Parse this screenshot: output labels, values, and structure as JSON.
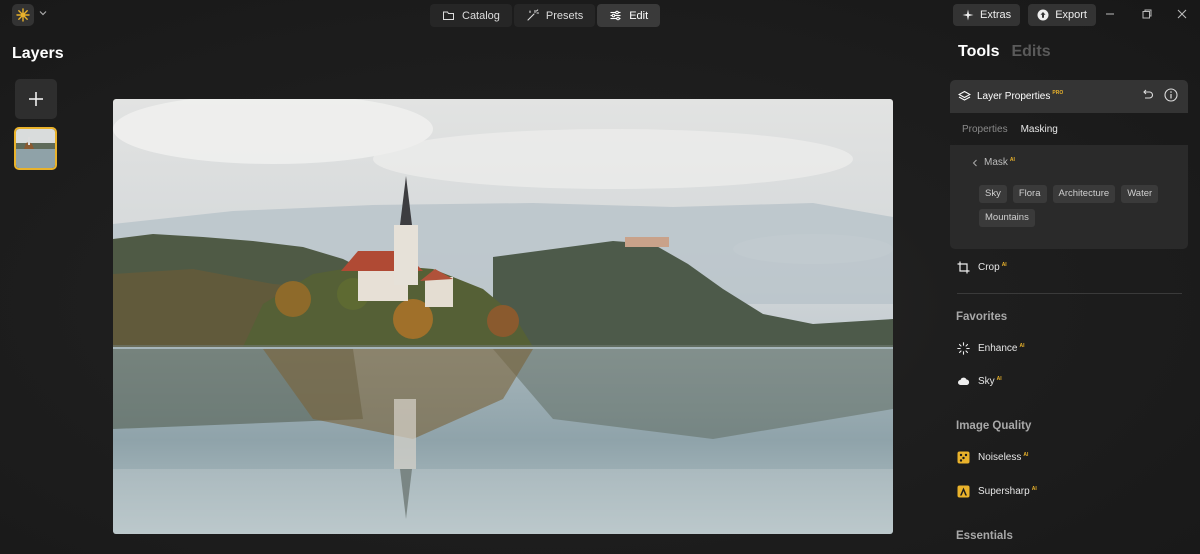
{
  "nav": {
    "catalog": "Catalog",
    "presets": "Presets",
    "edit": "Edit"
  },
  "actions": {
    "extras": "Extras",
    "export": "Export"
  },
  "layers": {
    "title": "Layers"
  },
  "tools_panel": {
    "tab_tools": "Tools",
    "tab_edits": "Edits",
    "layer_properties": {
      "title": "Layer Properties",
      "badge": "PRO",
      "subtabs": [
        "Properties",
        "Masking"
      ],
      "active_subtab": "Masking"
    },
    "mask": {
      "label": "Mask",
      "badge": "AI",
      "chips": [
        "Sky",
        "Flora",
        "Architecture",
        "Water",
        "Mountains"
      ]
    },
    "crop": {
      "label": "Crop",
      "badge": "AI"
    },
    "sections": {
      "favorites": "Favorites",
      "image_quality": "Image Quality",
      "essentials": "Essentials"
    },
    "favorites": [
      {
        "label": "Enhance",
        "badge": "AI",
        "icon": "enhance-icon"
      },
      {
        "label": "Sky",
        "badge": "AI",
        "icon": "cloud-icon"
      }
    ],
    "image_quality": [
      {
        "label": "Noiseless",
        "badge": "AI",
        "icon": "noiseless-icon"
      },
      {
        "label": "Supersharp",
        "badge": "AI",
        "icon": "supersharp-icon"
      }
    ]
  },
  "colors": {
    "accent": "#e9b22b",
    "panel": "#2a2a2a",
    "background": "#1c1c1c"
  }
}
